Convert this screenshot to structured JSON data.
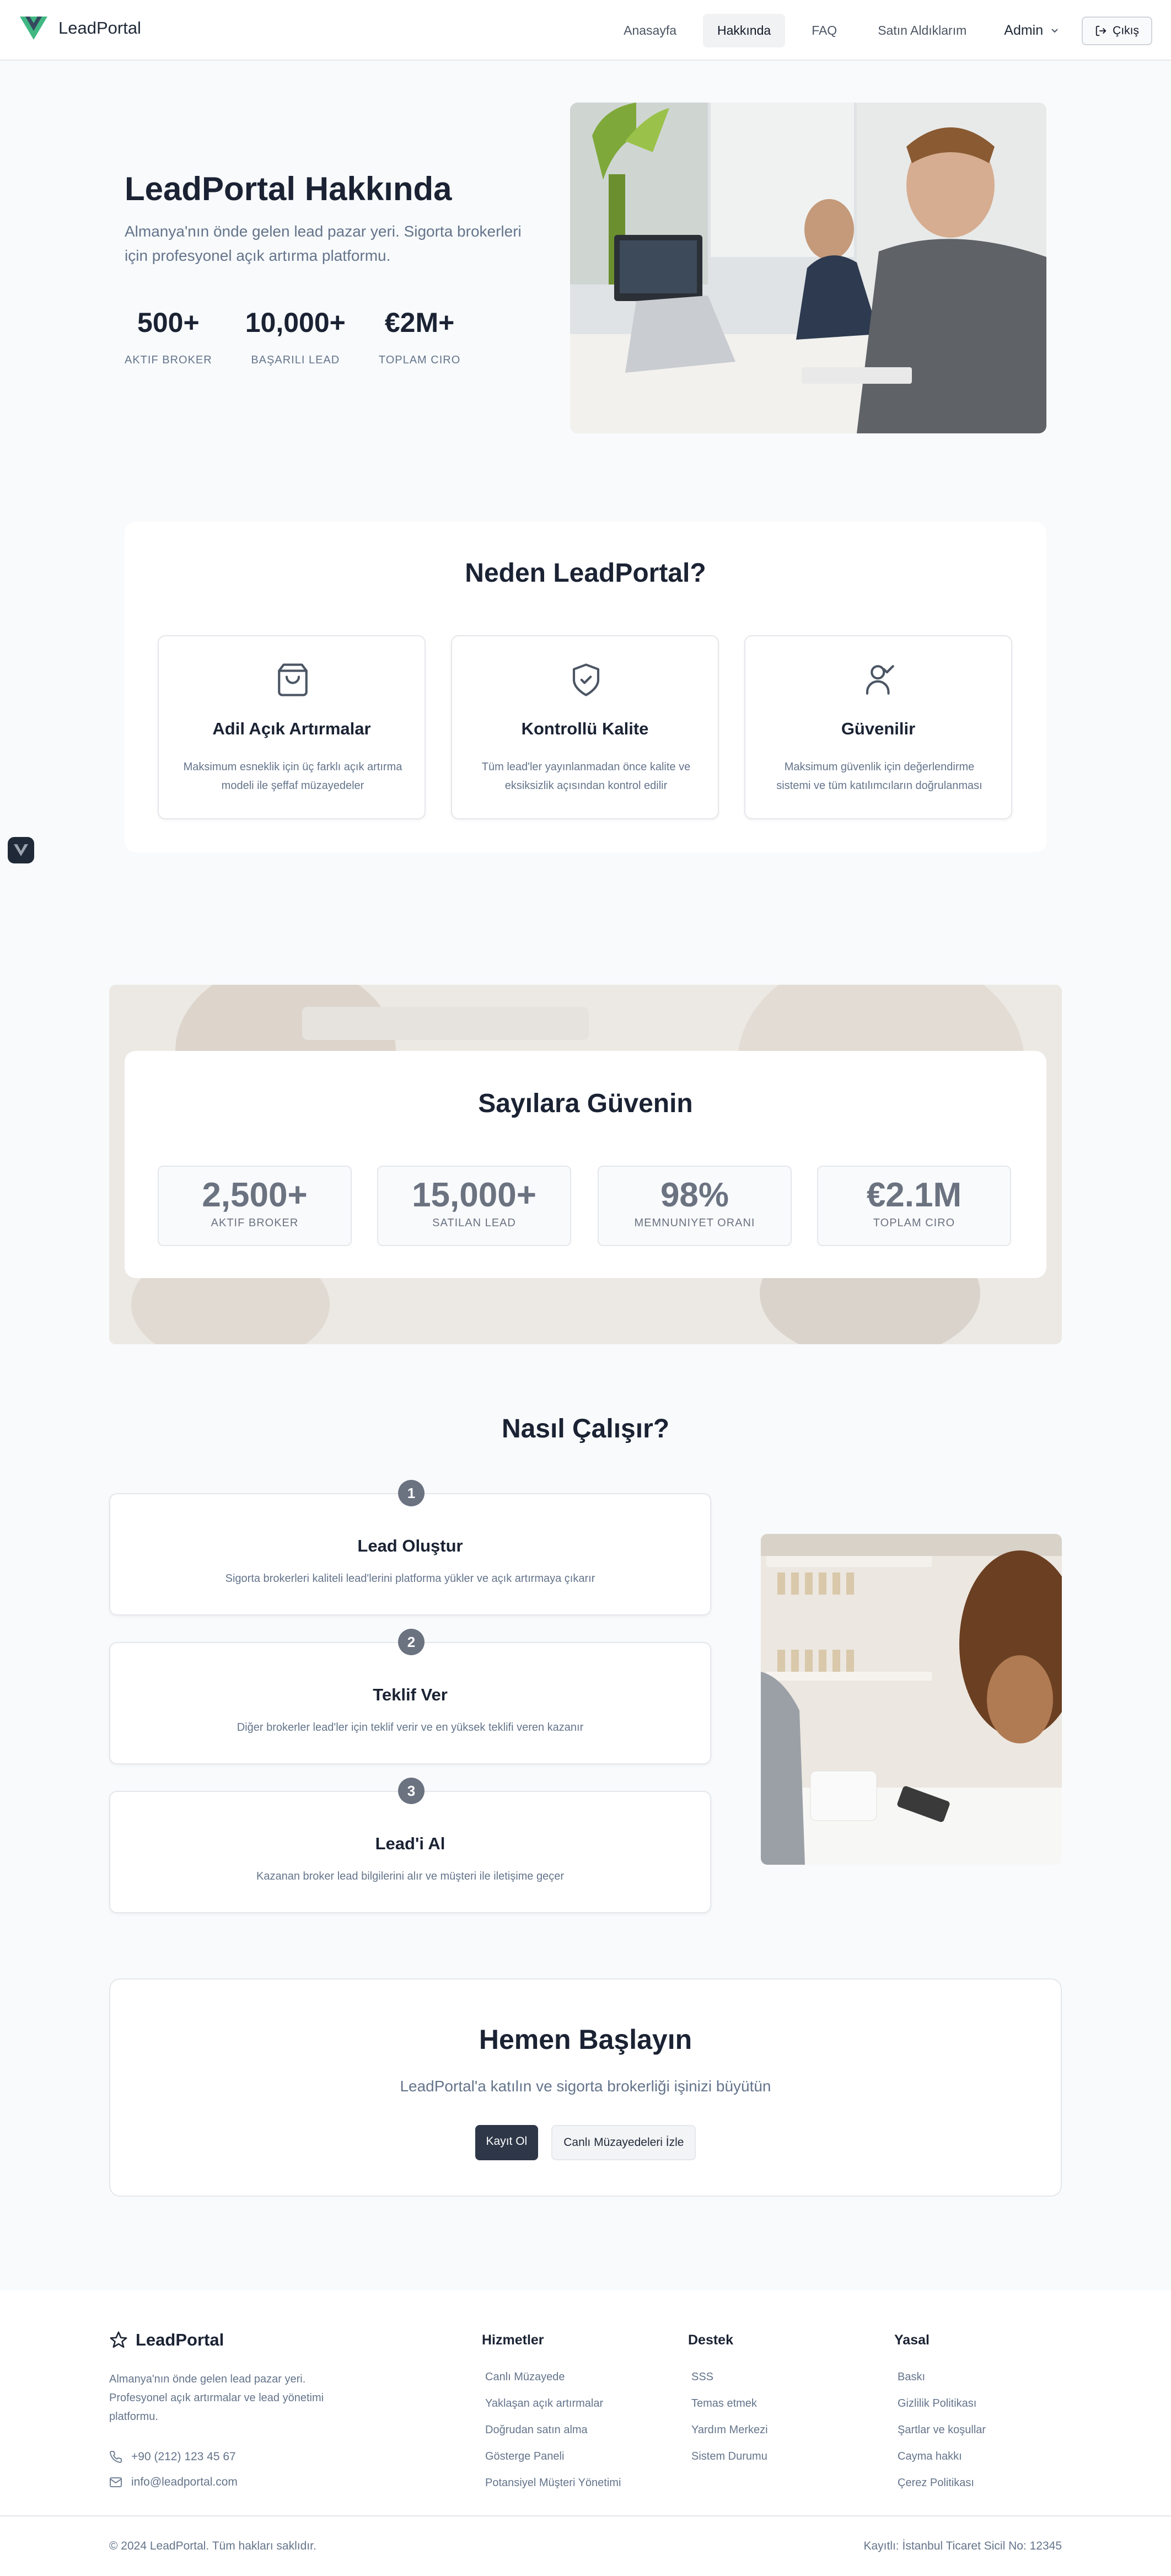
{
  "header": {
    "brand": "LeadPortal",
    "nav": [
      {
        "label": "Anasayfa",
        "active": false
      },
      {
        "label": "Hakkında",
        "active": true
      },
      {
        "label": "FAQ",
        "active": false
      },
      {
        "label": "Satın Aldıklarım",
        "active": false
      }
    ],
    "user_menu": "Admin",
    "logout_label": "Çıkış"
  },
  "hero": {
    "title": "LeadPortal Hakkında",
    "subtitle": "Almanya'nın önde gelen lead pazar yeri. Sigorta brokerleri için profesyonel açık artırma platformu.",
    "stats": [
      {
        "value": "500+",
        "label": "AKTIF BROKER"
      },
      {
        "value": "10,000+",
        "label": "BAŞARILI LEAD"
      },
      {
        "value": "€2M+",
        "label": "TOPLAM CIRO"
      }
    ]
  },
  "why": {
    "title": "Neden LeadPortal?",
    "features": [
      {
        "icon": "shopping-bag-icon",
        "title": "Adil Açık Artırmalar",
        "desc": "Maksimum esneklik için üç farklı açık artırma modeli ile şeffaf müzayedeler"
      },
      {
        "icon": "shield-check-icon",
        "title": "Kontrollü Kalite",
        "desc": "Tüm lead'ler yayınlanmadan önce kalite ve eksiksizlik açısından kontrol edilir"
      },
      {
        "icon": "user-check-icon",
        "title": "Güvenilir",
        "desc": "Maksimum güvenlik için değerlendirme sistemi ve tüm katılımcıların doğrulanması"
      }
    ]
  },
  "numbers": {
    "title": "Sayılara Güvenin",
    "items": [
      {
        "value": "2,500+",
        "label": "AKTIF BROKER"
      },
      {
        "value": "15,000+",
        "label": "SATILAN LEAD"
      },
      {
        "value": "98%",
        "label": "MEMNUNIYET ORANI"
      },
      {
        "value": "€2.1M",
        "label": "TOPLAM CIRO"
      }
    ]
  },
  "how": {
    "title": "Nasıl Çalışır?",
    "steps": [
      {
        "num": "1",
        "title": "Lead Oluştur",
        "desc": "Sigorta brokerleri kaliteli lead'lerini platforma yükler ve açık artırmaya çıkarır"
      },
      {
        "num": "2",
        "title": "Teklif Ver",
        "desc": "Diğer brokerler lead'ler için teklif verir ve en yüksek teklifi veren kazanır"
      },
      {
        "num": "3",
        "title": "Lead'i Al",
        "desc": "Kazanan broker lead bilgilerini alır ve müşteri ile iletişime geçer"
      }
    ]
  },
  "cta": {
    "title": "Hemen Başlayın",
    "subtitle": "LeadPortal'a katılın ve sigorta brokerliği işinizi büyütün",
    "primary": "Kayıt Ol",
    "secondary": "Canlı Müzayedeleri İzle"
  },
  "footer": {
    "brand": "LeadPortal",
    "desc": "Almanya'nın önde gelen lead pazar yeri. Profesyonel açık artırmalar ve lead yönetimi platformu.",
    "phone": "+90 (212) 123 45 67",
    "email": "info@leadportal.com",
    "columns": [
      {
        "title": "Hizmetler",
        "links": [
          "Canlı Müzayede",
          "Yaklaşan açık artırmalar",
          "Doğrudan satın alma",
          "Gösterge Paneli",
          "Potansiyel Müşteri Yönetimi"
        ]
      },
      {
        "title": "Destek",
        "links": [
          "SSS",
          "Temas etmek",
          "Yardım Merkezi",
          "Sistem Durumu"
        ]
      },
      {
        "title": "Yasal",
        "links": [
          "Baskı",
          "Gizlilik Politikası",
          "Şartlar ve koşullar",
          "Cayma hakkı",
          "Çerez Politikası"
        ]
      }
    ],
    "copyright": "© 2024 LeadPortal. Tüm hakları saklıdır.",
    "registry": "Kayıtlı: İstanbul Ticaret Sicil No: 12345"
  },
  "colors": {
    "brand_green": "#41b883",
    "brand_dark": "#35495e",
    "heading": "#1a2233",
    "muted": "#64748b",
    "background": "#f8fafc"
  }
}
